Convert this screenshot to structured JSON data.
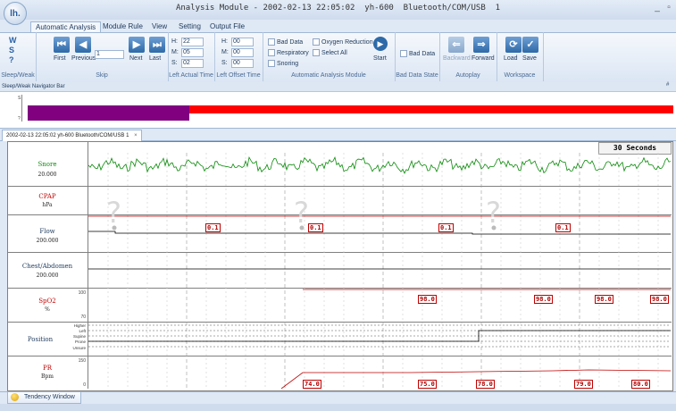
{
  "window": {
    "title": "Analysis Module - 2002-02-13 22:05:02  yh-600  Bluetooth/COM/USB  1",
    "minimize_glyph": "_",
    "restore_glyph": "▫",
    "logo_text": "lh."
  },
  "ribbon": {
    "tabs": [
      "Automatic Analysis",
      "Module Rule",
      "View",
      "Setting",
      "Output File"
    ],
    "active_tab": "Automatic Analysis",
    "sleepwake": {
      "items": [
        "W",
        "S",
        "?"
      ],
      "group_label": "Sleep/Weak"
    },
    "skip": {
      "first": "First",
      "previous": "Previous",
      "page_value": "1",
      "next": "Next",
      "last": "Last",
      "group_label": "Skip"
    },
    "actual_time": {
      "h": "22",
      "m": "05",
      "s": "02",
      "h_label": "H:",
      "m_label": "M:",
      "s_label": "S:",
      "group_label": "Left Actual Time"
    },
    "offset_time": {
      "h": "00",
      "m": "00",
      "s": "00",
      "h_label": "H:",
      "m_label": "M:",
      "s_label": "S:",
      "group_label": "Left Offset Time"
    },
    "analysis": {
      "bad_data": "Bad Data",
      "oxygen_reduction": "Oxygen Reduction",
      "respiratory": "Respiratory",
      "select_all": "Select All",
      "snoring": "Snoring",
      "start": "Start",
      "group_label": "Automatic Analysis Module"
    },
    "bad_data_state": {
      "bad_data": "Bad Data",
      "group_label": "Bad Data State"
    },
    "autoplay": {
      "backward": "Backward",
      "forward": "Forward",
      "group_label": "Autoplay"
    },
    "workspace": {
      "load": "Load",
      "save": "Save",
      "group_label": "Workspace"
    }
  },
  "navigator": {
    "title": "Sleep/Weak Navigator Bar",
    "pin_glyph": "#",
    "levels": [
      "S",
      "?"
    ],
    "wake_color": "#800080",
    "rem_color": "#ff0000"
  },
  "document_tab": {
    "label": "2002-02-13 22:05:02  yh-600  Bluetooth/COM/USB  1",
    "close": "×"
  },
  "chart": {
    "time_scale": "30 Seconds",
    "channels": [
      {
        "name": "Snore",
        "value": "20.000",
        "color": "#0a8a0a"
      },
      {
        "name": "CPAP",
        "unit": "hPa",
        "color": "#c00000"
      },
      {
        "name": "Flow",
        "value": "200.000",
        "color": "#000000"
      },
      {
        "name": "Chest/Abdomen",
        "value": "200.000",
        "color": "#000000"
      },
      {
        "name": "SpO2",
        "unit": "%",
        "max": "100",
        "min": "70",
        "color": "#c00000"
      },
      {
        "name": "Position",
        "levels": [
          "Higher",
          "Left",
          "Supine",
          "Prone",
          "Unsure"
        ],
        "color": "#000000"
      },
      {
        "name": "PR",
        "unit": "Bpm",
        "max": "150",
        "min": "0",
        "color": "#c00000"
      }
    ],
    "cpap_values": [
      "0.1",
      "0.1",
      "0.1",
      "0.1"
    ],
    "spo2_values": [
      "98.0",
      "98.0",
      "98.0",
      "98.0"
    ],
    "pr_values": [
      "74.0",
      "75.0",
      "78.0",
      "79.0",
      "80.0"
    ],
    "unknown_marker": "?"
  },
  "tendency": {
    "label": "Tendency Window"
  }
}
